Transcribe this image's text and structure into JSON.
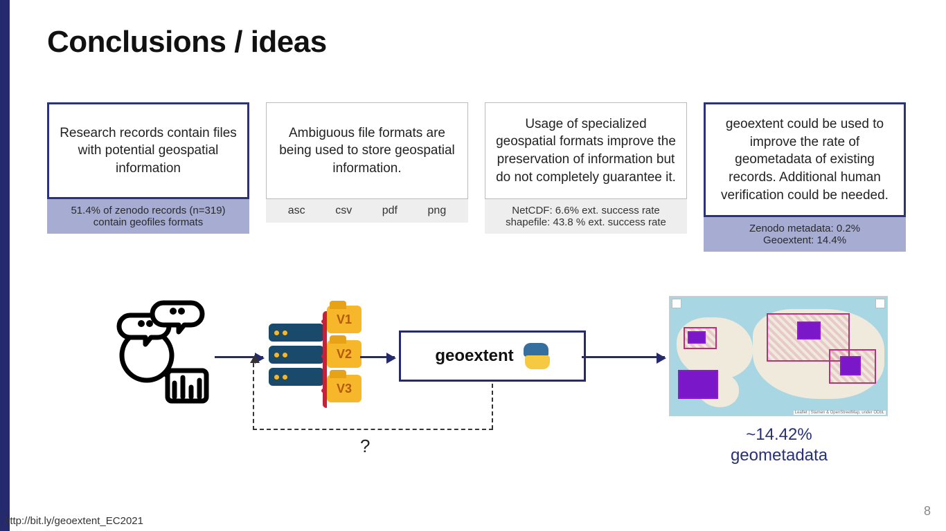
{
  "title": "Conclusions / ideas",
  "cards": [
    {
      "heading": "Research records contain files with potential geospatial information",
      "sub": "51.4% of zenodo records (n=319) contain geofiles formats",
      "primary": true,
      "purple": true
    },
    {
      "heading": "Ambiguous file formats are being used to store geospatial information.",
      "formats": [
        "asc",
        "csv",
        "pdf",
        "png"
      ]
    },
    {
      "heading": "Usage of specialized geospatial formats improve the preservation of information but do not completely guarantee it.",
      "sub_lines": [
        "NetCDF: 6.6% ext. success rate",
        "shapefile: 43.8 % ext. success rate"
      ]
    },
    {
      "heading": "geoextent could be used to improve the rate of geometadata of existing records. Additional human verification could be needed.",
      "sub_lines": [
        "Zenodo metadata: 0.2%",
        "Geoextent: 14.4%"
      ],
      "primary": true,
      "purple": true
    }
  ],
  "versions": [
    "V1",
    "V2",
    "V3"
  ],
  "geobox_label": "geoextent",
  "question_mark": "?",
  "map_caption_line1": "~14.42%",
  "map_caption_line2": "geometadata",
  "map_attrib": "Leaflet | Stamen & OpenStreetMap, under ODbL",
  "footer_link": "http://bit.ly/geoextent_EC2021",
  "page_number": "8"
}
